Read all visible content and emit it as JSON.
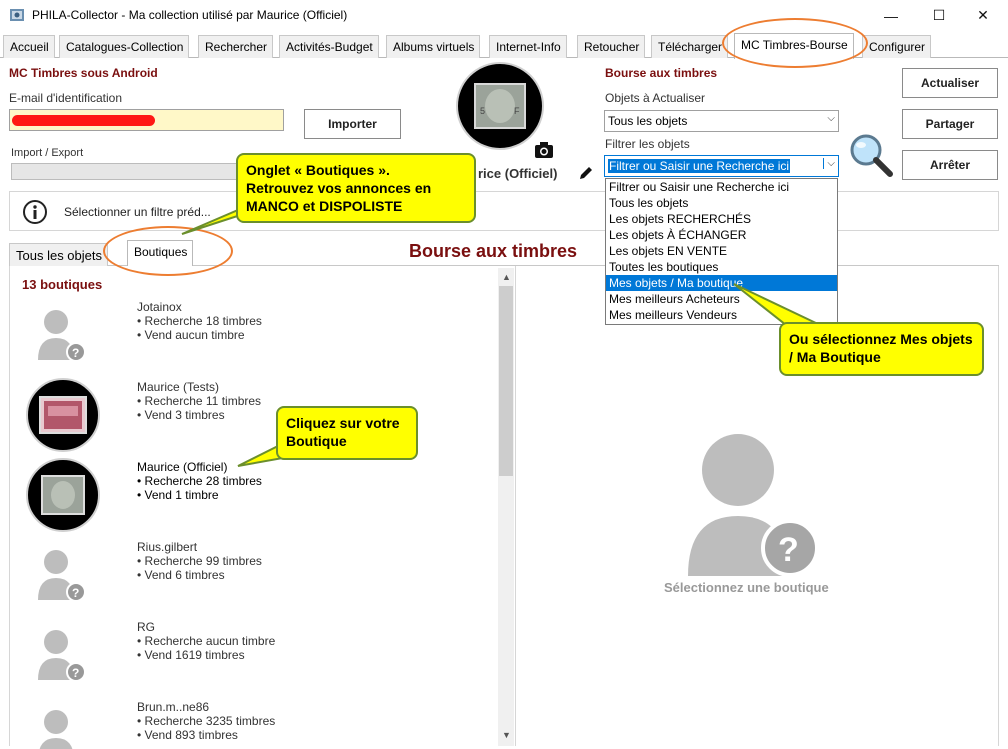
{
  "window": {
    "title": "PHILA-Collector - Ma collection utilisé par Maurice (Officiel)",
    "minimize": "—",
    "maximize": "☐",
    "close": "✕"
  },
  "tabs": [
    "Accueil",
    "Catalogues-Collection",
    "Rechercher",
    "Activités-Budget",
    "Albums virtuels",
    "Internet-Info",
    "Retoucher",
    "Télécharger",
    "MC Timbres-Bourse",
    "Configurer"
  ],
  "left": {
    "section_title": "MC Timbres sous Android",
    "email_label": "E-mail d'identification",
    "email_value": "",
    "import_button": "Importer",
    "import_export_label": "Import / Export"
  },
  "profile": {
    "name_partial": "rice (Officiel)"
  },
  "filter_bar": {
    "text": "Sélectionner un filtre préd..."
  },
  "subtabs": [
    "Tous les objets",
    "Boutiques"
  ],
  "bourse_heading": "Bourse aux timbres",
  "right": {
    "title": "Bourse aux timbres",
    "objects_label": "Objets à Actualiser",
    "objects_value": "Tous les objets",
    "filter_label": "Filtrer les objets",
    "filter_value": "Filtrer ou Saisir une Recherche ici",
    "dropdown_options": [
      "Filtrer ou Saisir une Recherche ici",
      "Tous les objets",
      "Les objets RECHERCHÉS",
      "Les objets À ÉCHANGER",
      "Les objets EN VENTE",
      "Toutes les boutiques",
      "Mes objets / Ma boutique",
      "Mes meilleurs Acheteurs",
      "Mes meilleurs Vendeurs"
    ],
    "selected_index": 6,
    "buttons": {
      "refresh": "Actualiser",
      "share": "Partager",
      "stop": "Arrêter"
    }
  },
  "shops": {
    "count_label": "13 boutiques",
    "items": [
      {
        "name": "Jotainox",
        "l1": "• Recherche 18 timbres",
        "l2": "• Vend aucun timbre"
      },
      {
        "name": "Maurice (Tests)",
        "l1": "• Recherche 11 timbres",
        "l2": "• Vend 3 timbres"
      },
      {
        "name": "Maurice (Officiel)",
        "l1": "• Recherche 28 timbres",
        "l2": "• Vend 1 timbre"
      },
      {
        "name": "Rius.gilbert",
        "l1": "• Recherche 99 timbres",
        "l2": "• Vend 6 timbres"
      },
      {
        "name": "RG",
        "l1": "• Recherche aucun timbre",
        "l2": "• Vend 1619 timbres"
      },
      {
        "name": "Brun.m..ne86",
        "l1": "• Recherche 3235 timbres",
        "l2": "• Vend 893 timbres"
      }
    ]
  },
  "detail": {
    "placeholder": "Sélectionnez une boutique"
  },
  "callouts": {
    "boutiques_tab": "Onglet « Boutiques ».\nRetrouvez vos annonces en MANCO et DISPOLISTE",
    "select_mine": "Ou sélectionnez Mes objets / Ma Boutique",
    "click_shop": "Cliquez sur votre Boutique"
  },
  "colors": {
    "accent_red": "#7a0f0f",
    "selection_blue": "#0078d7",
    "callout_yellow": "#ffff00",
    "ellipse_orange": "#ed7d31"
  }
}
